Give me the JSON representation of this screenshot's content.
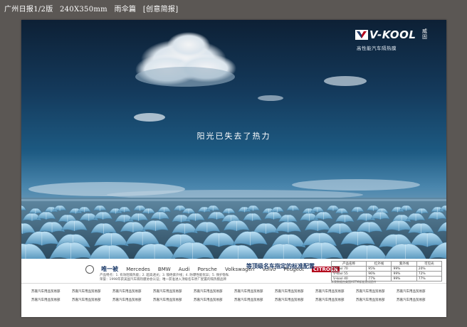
{
  "caption": {
    "paper": "广州日报1/2版",
    "size": "240X350mm",
    "title": "雨伞篇",
    "note": "[创意简报]"
  },
  "ad": {
    "logo_text": "V-KOOL",
    "logo_cn": "威固",
    "logo_sub": "高性能汽车隔热膜",
    "headline": "阳光已失去了热力"
  },
  "strip": {
    "brands": [
      "唯一被",
      "Mercedes",
      "BMW",
      "Audi",
      "Porsche",
      "Volkswagen",
      "Volvo",
      "Peugeot",
      "CITROEN"
    ],
    "standard": "等顶级名车指定的标准配置",
    "fine_1": "产品特点：1. 有效阻隔热能；2. 超高透光；3. 隔绝紫外线；4. 防爆性能优异；5. 保护隐私",
    "fine_2": "荣誉：1998年获美国汽车隔热膜协会认证；唯一获准进入顶级名车原厂配置的隔热膜品牌",
    "table_headers": [
      "产品名称",
      "红外线",
      "紫外线",
      "可见光"
    ],
    "table_rows": [
      [
        "V-kool 70",
        "95%",
        "99%",
        "20%"
      ],
      [
        "V-kool 55",
        "96%",
        "99%",
        "72%"
      ],
      [
        "V-kool 40",
        "77%",
        "99%",
        "77%"
      ]
    ],
    "table_note": "本表数据由美国ASTM标准测试提供"
  },
  "dealers": [
    "苏嘉汽车用品贸易部",
    "苏嘉汽车用品贸易部",
    "苏嘉汽车用品贸易部",
    "苏嘉汽车用品贸易部",
    "苏嘉汽车用品贸易部",
    "苏嘉汽车用品贸易部",
    "苏嘉汽车用品贸易部",
    "苏嘉汽车用品贸易部",
    "苏嘉汽车用品贸易部",
    "苏嘉汽车用品贸易部",
    "苏嘉汽车用品贸易部",
    "苏嘉汽车用品贸易部",
    "苏嘉汽车用品贸易部",
    "苏嘉汽车用品贸易部",
    "苏嘉汽车用品贸易部",
    "苏嘉汽车用品贸易部",
    "苏嘉汽车用品贸易部",
    "苏嘉汽车用品贸易部",
    "苏嘉汽车用品贸易部",
    "苏嘉汽车用品贸易部"
  ],
  "colors": {
    "frame": "#5b5754",
    "sky": "#143a5c",
    "umbrella": "#8cc4e4",
    "brand_blue": "#1f3d6b"
  }
}
